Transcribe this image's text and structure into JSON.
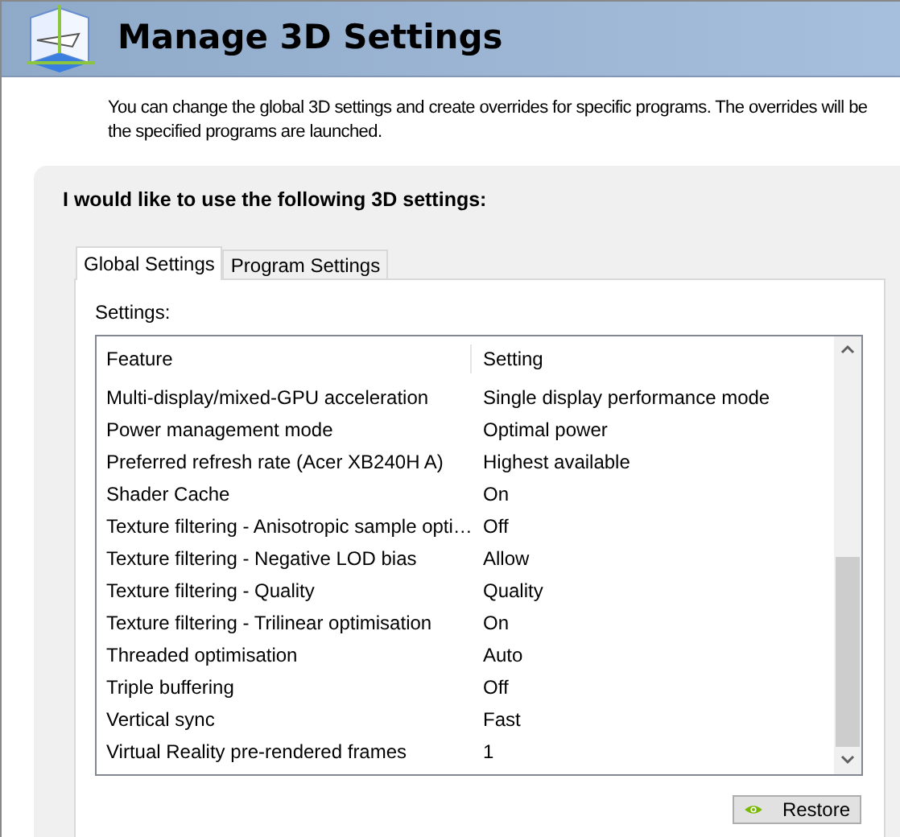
{
  "header": {
    "title": "Manage 3D Settings"
  },
  "description": [
    "You can change the global 3D settings and create overrides for specific programs. The overrides will be",
    "the specified programs are launched."
  ],
  "panel": {
    "heading": "I would like to use the following 3D settings:"
  },
  "tabs": [
    {
      "label": "Global Settings",
      "selected": true
    },
    {
      "label": "Program Settings",
      "selected": false
    }
  ],
  "settings_label": "Settings:",
  "table": {
    "columns": [
      "Feature",
      "Setting"
    ],
    "rows": [
      {
        "feature": "Multi-display/mixed-GPU acceleration",
        "setting": "Single display performance mode"
      },
      {
        "feature": "Power management mode",
        "setting": "Optimal power"
      },
      {
        "feature": "Preferred refresh rate (Acer XB240H A)",
        "setting": "Highest available"
      },
      {
        "feature": "Shader Cache",
        "setting": "On"
      },
      {
        "feature": "Texture filtering - Anisotropic sample opti…",
        "setting": "Off"
      },
      {
        "feature": "Texture filtering - Negative LOD bias",
        "setting": "Allow"
      },
      {
        "feature": "Texture filtering - Quality",
        "setting": "Quality"
      },
      {
        "feature": "Texture filtering - Trilinear optimisation",
        "setting": "On"
      },
      {
        "feature": "Threaded optimisation",
        "setting": "Auto"
      },
      {
        "feature": "Triple buffering",
        "setting": "Off"
      },
      {
        "feature": "Vertical sync",
        "setting": "Fast"
      },
      {
        "feature": "Virtual Reality pre-rendered frames",
        "setting": "1"
      }
    ]
  },
  "buttons": [
    {
      "label": "Restore"
    }
  ]
}
